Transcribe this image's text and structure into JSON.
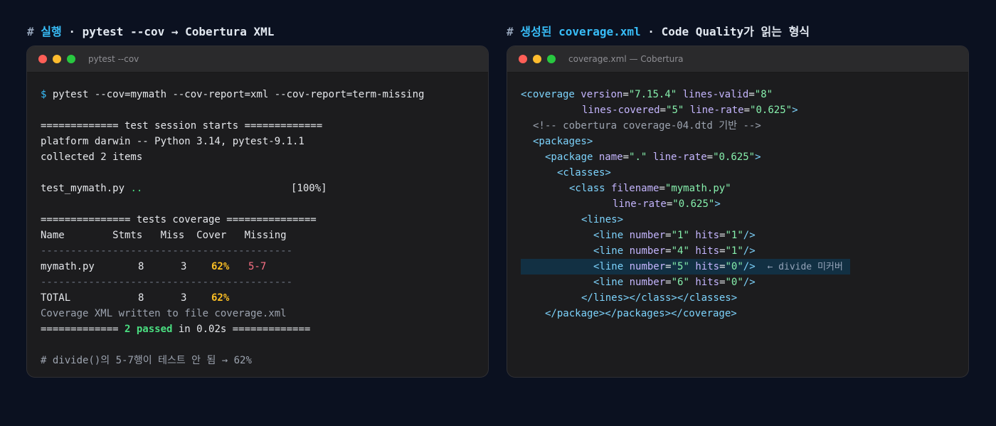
{
  "left_heading": {
    "hash": "#",
    "accent": "실행",
    "rest": " · pytest --cov → Cobertura XML"
  },
  "right_heading": {
    "hash": "#",
    "accent": "생성된 coverage.xml",
    "rest": " · Code Quality가 읽는 형식"
  },
  "terminal": {
    "title": "pytest --cov",
    "command": {
      "prompt": "$",
      "text": " pytest --cov=mymath --cov-report=xml --cov-report=term-missing"
    },
    "session_header": "============= test session starts =============",
    "platform": "platform darwin -- Python 3.14, pytest-9.1.1",
    "collected": "collected 2 items",
    "test_file": "test_mymath.py",
    "test_dots": "..",
    "test_percent": "[100%]",
    "coverage_header": "=============== tests coverage ===============",
    "table_header": "Name        Stmts   Miss  Cover   Missing",
    "separator": "------------------------------------------",
    "row": {
      "name": "mymath.py",
      "stmts": "8",
      "miss": "3",
      "cover": "62%",
      "missing": "5-7"
    },
    "total": {
      "name": "TOTAL",
      "stmts": "8",
      "miss": "3",
      "cover": "62%"
    },
    "xml_written": "Coverage XML written to file coverage.xml",
    "summary": {
      "left": "============= ",
      "passed": "2 passed",
      "mid": " in 0.02s ",
      "right": "============="
    },
    "comment": "# divide()의 5-7행이 테스트 안 됨 → 62%"
  },
  "xml_view": {
    "title": "coverage.xml — Cobertura",
    "coverage": {
      "version": "\"7.15.4\"",
      "lines_valid": "\"8\"",
      "lines_covered": "\"5\"",
      "line_rate": "\"0.625\""
    },
    "dtd_comment": "<!-- cobertura coverage-04.dtd 기반 -->",
    "package": {
      "name": "\".\"",
      "line_rate": "\"0.625\""
    },
    "class": {
      "filename": "\"mymath.py\"",
      "line_rate": "\"0.625\""
    },
    "lines": [
      {
        "number": "\"1\"",
        "hits": "\"1\""
      },
      {
        "number": "\"4\"",
        "hits": "\"1\""
      },
      {
        "number": "\"5\"",
        "hits": "\"0\""
      },
      {
        "number": "\"6\"",
        "hits": "\"0\""
      }
    ],
    "uncovered_note": "← divide 미커버"
  }
}
